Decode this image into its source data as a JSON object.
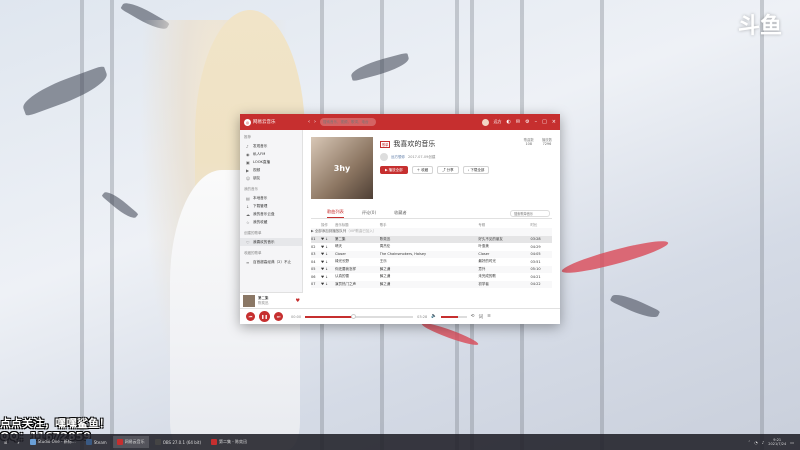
{
  "watermark": {
    "logo_text": "斗鱼"
  },
  "stream_overlay": {
    "line1": "点点关注，嘿嘿鲨鱼！",
    "line2": "QQ：11672859"
  },
  "app": {
    "brand": "网易云音乐",
    "search_placeholder": "搜索音乐，视频，歌词，电台",
    "user_name": "远方",
    "sidebar": {
      "section_recommend": "推荐",
      "recommend_items": [
        "发现音乐",
        "私人FM",
        "LOOK直播",
        "视频",
        "朋友"
      ],
      "section_my_music": "我的音乐",
      "my_music_items": [
        "本地音乐",
        "下载管理",
        "我的音乐云盘",
        "我的收藏"
      ],
      "section_created": "创建的歌单",
      "created_items": [
        "我喜欢的音乐"
      ],
      "section_collected": "收藏的歌单",
      "collected_items": [
        "百首超高经典（2）不止"
      ]
    },
    "mini_player": {
      "title": "第二集",
      "artist": "陈奕迅"
    },
    "playlist": {
      "tag": "歌单",
      "title": "我喜欢的音乐",
      "cover_text": "3hy",
      "creator": "远方想你",
      "created": "2017-07-09创建",
      "buttons": {
        "play_all": "播放全部",
        "collect": "收藏",
        "share": "分享",
        "download": "下载全部"
      },
      "stats": [
        {
          "label": "歌曲数",
          "value": "108"
        },
        {
          "label": "播放数",
          "value": "7296"
        }
      ]
    },
    "tabs": [
      "歌曲列表",
      "评论(0)",
      "收藏者"
    ],
    "list_search_placeholder": "搜索歌单音乐",
    "table": {
      "headers": [
        "操作",
        "音乐标题",
        "歌手",
        "专辑",
        "时长"
      ],
      "add_all_text": "全部添加到播放队列",
      "add_all_hint": "（VIP歌曲已加入）",
      "rows": [
        {
          "idx": "01",
          "title": "第二集",
          "artist": "陈奕迅",
          "album": "好久不见的朋友",
          "time": "03:28"
        },
        {
          "idx": "02",
          "title": "晴天",
          "artist": "周杰伦",
          "album": "叶惠美",
          "time": "04:29"
        },
        {
          "idx": "03",
          "title": "Closer",
          "artist": "The Chainsmokers, Halsey",
          "album": "Closer",
          "time": "04:05"
        },
        {
          "idx": "04",
          "title": "绿光长野",
          "artist": "王乐",
          "album": "最好的时光",
          "time": "03:51"
        },
        {
          "idx": "05",
          "title": "你还要我怎样",
          "artist": "薛之谦",
          "album": "意外",
          "time": "05:10"
        },
        {
          "idx": "06",
          "title": "认真的雪",
          "artist": "薛之谦",
          "album": "未完成的歌",
          "time": "04:21"
        },
        {
          "idx": "07",
          "title": "演员热门之声",
          "artist": "薛之谦",
          "album": "初学者",
          "time": "04:22"
        }
      ]
    },
    "player": {
      "current_time": "00:00",
      "total_time": "03:28",
      "progress": 0.45,
      "volume": 0.65
    }
  },
  "taskbar": {
    "tasks": [
      "Studio One - 新标…",
      "Steam",
      "网易云音乐",
      "OBS 27.0.1 (64 bit)",
      "第二集 - 陈奕迅"
    ],
    "time": "9:21",
    "date": "2021/7/24"
  },
  "colors": {
    "accent": "#c62f2f",
    "link": "#5b7aa6"
  }
}
